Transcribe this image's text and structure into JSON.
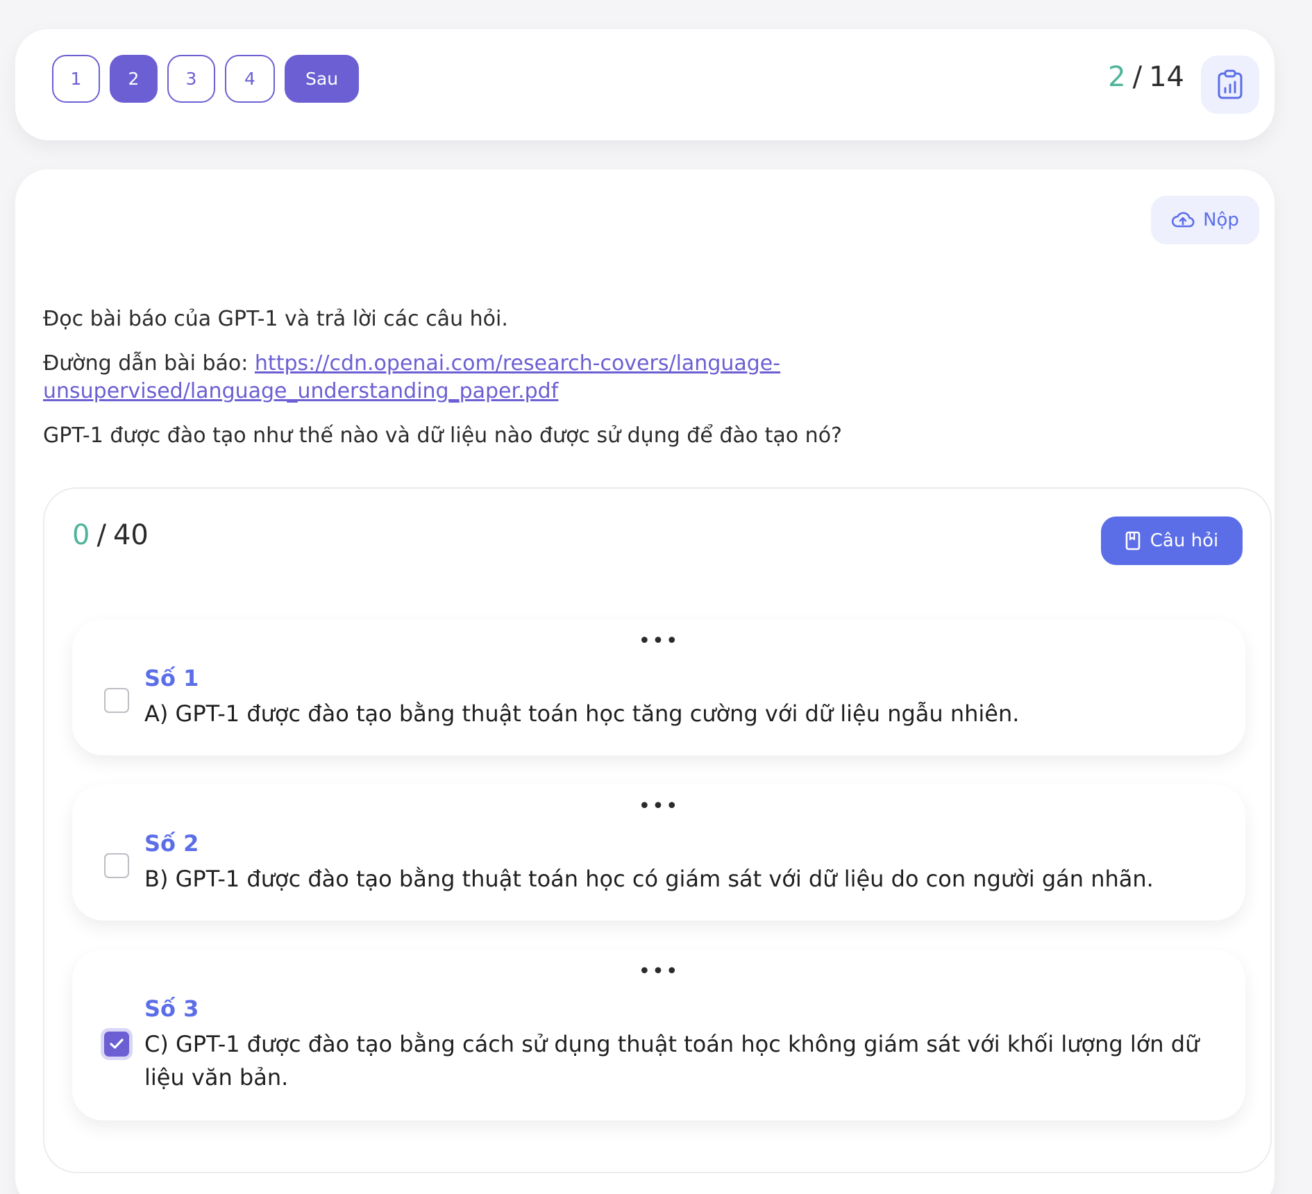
{
  "nav": {
    "pages": [
      "1",
      "2",
      "3",
      "4"
    ],
    "active_page": "2",
    "next_label": "Sau",
    "progress_current": "2",
    "progress_sep": "/",
    "progress_total": "14"
  },
  "main": {
    "submit_label": "Nộp",
    "instruction": "Đọc bài báo của GPT-1 và trả lời các câu hỏi.",
    "link_prefix": "Đường dẫn bài báo: ",
    "link_text": "https://cdn.openai.com/research-covers/language-unsupervised/language_understanding_paper.pdf",
    "question": "GPT-1 được đào tạo như thế nào và dữ liệu nào được sử dụng để đào tạo nó?"
  },
  "answers": {
    "score_current": "0",
    "score_sep": "/",
    "score_total": "40",
    "questions_button": "Câu hỏi",
    "options": [
      {
        "number": "Số 1",
        "text": "A) GPT-1 được đào tạo bằng thuật toán học tăng cường với dữ liệu ngẫu nhiên.",
        "checked": false
      },
      {
        "number": "Số 2",
        "text": "B) GPT-1 được đào tạo bằng thuật toán học có giám sát với dữ liệu do con người gán nhãn.",
        "checked": false
      },
      {
        "number": "Số 3",
        "text": "C) GPT-1 được đào tạo bằng cách sử dụng thuật toán học không giám sát với khối lượng lớn dữ liệu văn bản.",
        "checked": true
      }
    ]
  },
  "colors": {
    "accent": "#6b5fd3",
    "primary_blue": "#5b6ee8",
    "progress_green": "#4fb49a"
  }
}
